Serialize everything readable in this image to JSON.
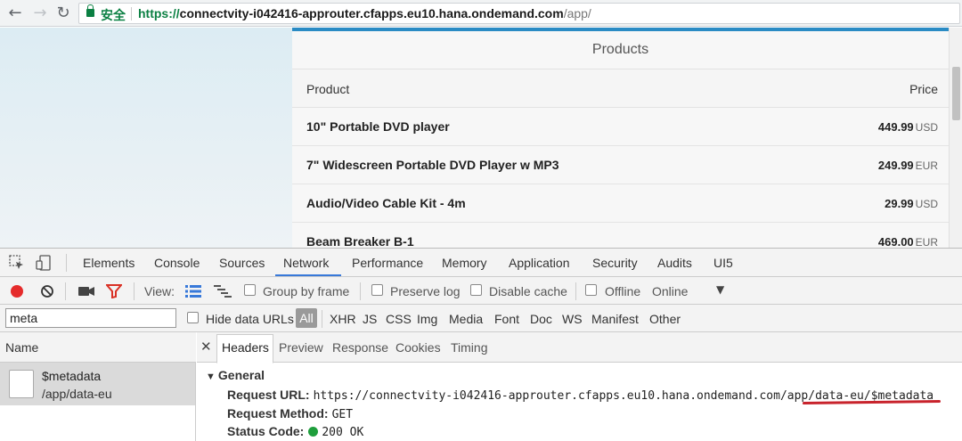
{
  "browser": {
    "secure_label": "安全",
    "url_protocol": "https://",
    "url_host": "connectvity-i042416-approuter.cfapps.eu10.hana.ondemand.com",
    "url_path": "/app/"
  },
  "products": {
    "title": "Products",
    "col_product": "Product",
    "col_price": "Price",
    "rows": [
      {
        "name": "10\" Portable DVD player",
        "price": "449.99",
        "currency": "USD"
      },
      {
        "name": "7\" Widescreen Portable DVD Player w MP3",
        "price": "249.99",
        "currency": "EUR"
      },
      {
        "name": "Audio/Video Cable Kit - 4m",
        "price": "29.99",
        "currency": "USD"
      },
      {
        "name": "Beam Breaker B-1",
        "price": "469.00",
        "currency": "EUR"
      }
    ]
  },
  "devtools": {
    "tabs": [
      "Elements",
      "Console",
      "Sources",
      "Network",
      "Performance",
      "Memory",
      "Application",
      "Security",
      "Audits",
      "UI5"
    ],
    "active_tab": "Network",
    "toolbar": {
      "view_label": "View:",
      "group_by_frame": "Group by frame",
      "preserve_log": "Preserve log",
      "disable_cache": "Disable cache",
      "offline": "Offline",
      "throttle": "Online"
    },
    "filter": {
      "value": "meta",
      "hide_data_urls": "Hide data URLs",
      "types": [
        "All",
        "XHR",
        "JS",
        "CSS",
        "Img",
        "Media",
        "Font",
        "Doc",
        "WS",
        "Manifest",
        "Other"
      ]
    },
    "name_header": "Name",
    "request": {
      "name": "$metadata",
      "path": "/app/data-eu"
    },
    "detail_tabs": [
      "Headers",
      "Preview",
      "Response",
      "Cookies",
      "Timing"
    ],
    "active_detail_tab": "Headers",
    "general": {
      "title": "General",
      "request_url_label": "Request URL:",
      "request_url": "https://connectvity-i042416-approuter.cfapps.eu10.hana.ondemand.com/app/data-eu/$metadata",
      "request_method_label": "Request Method:",
      "request_method": "GET",
      "status_code_label": "Status Code:",
      "status_code": "200 OK"
    },
    "colors": {
      "record": "#e52b2b",
      "filter_active": "#d93025",
      "status_ok": "#1e9e3c",
      "highlight": "#c8232c"
    }
  }
}
